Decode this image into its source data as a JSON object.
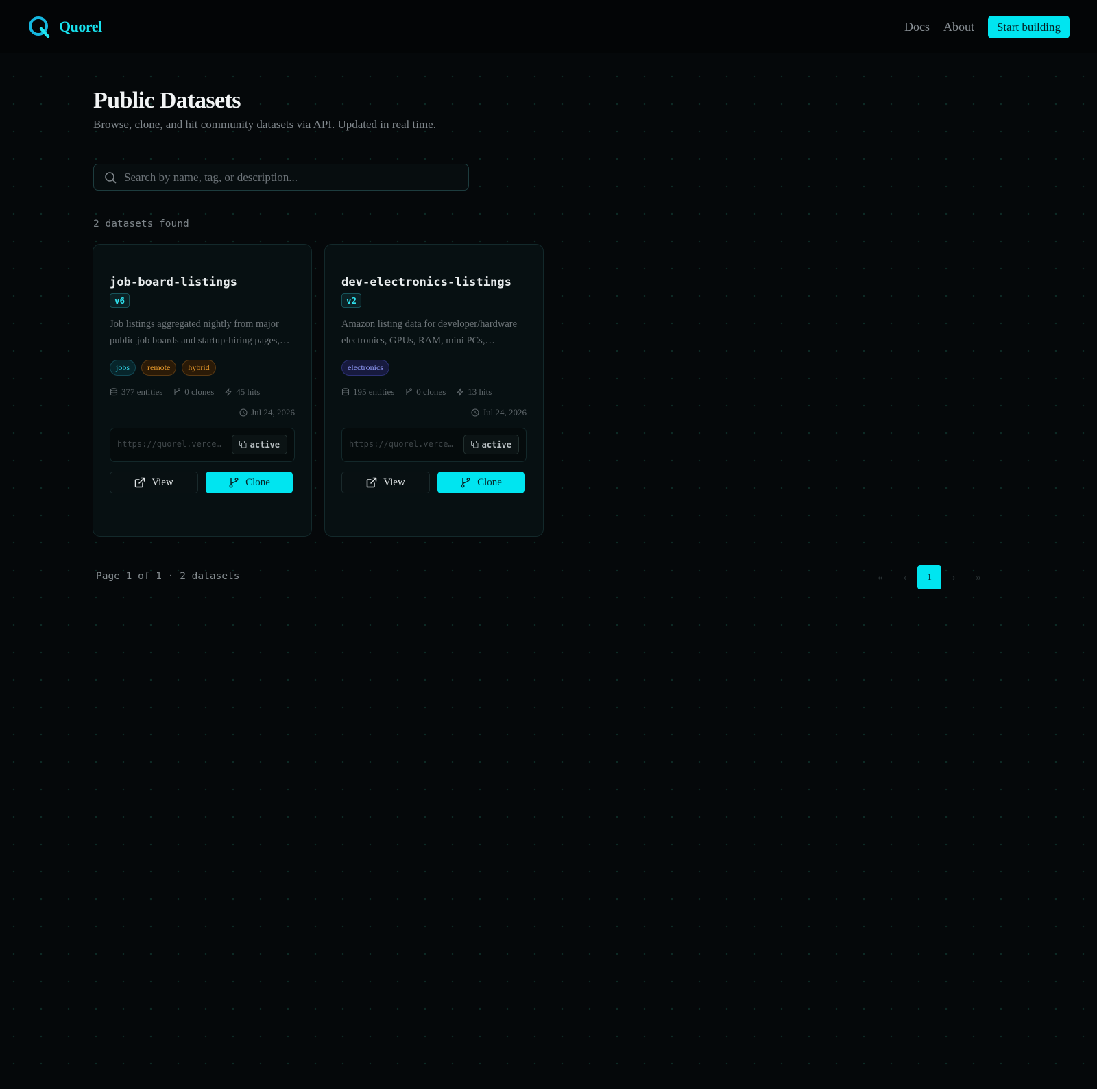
{
  "header": {
    "brand": "Quorel",
    "nav": {
      "docs": "Docs",
      "about": "About"
    },
    "cta": "Start building"
  },
  "page": {
    "title": "Public Datasets",
    "subtitle": "Browse, clone, and hit community datasets via API. Updated in real time."
  },
  "search": {
    "placeholder": "Search by name, tag, or description..."
  },
  "results": {
    "count_label": "2 datasets found"
  },
  "datasets": [
    {
      "name": "job-board-listings",
      "version": "v6",
      "description": "Job listings aggregated nightly from major public job boards and startup-hiring pages,…",
      "tags": [
        "jobs",
        "remote",
        "hybrid"
      ],
      "entities": "377 entities",
      "clones": "0 clones",
      "hits": "45 hits",
      "date": "Jul 24, 2026",
      "endpoint": "https://quorel.verce…",
      "status": "active",
      "view_label": "View",
      "clone_label": "Clone"
    },
    {
      "name": "dev-electronics-listings",
      "version": "v2",
      "description": "Amazon listing data for developer/hardware electronics, GPUs, RAM, mini PCs,…",
      "tags": [
        "electronics"
      ],
      "entities": "195 entities",
      "clones": "0 clones",
      "hits": "13 hits",
      "date": "Jul 24, 2026",
      "endpoint": "https://quorel.verce…",
      "status": "active",
      "view_label": "View",
      "clone_label": "Clone"
    }
  ],
  "pagination": {
    "info": "Page 1 of 1 · 2 datasets",
    "first": "«",
    "prev": "‹",
    "current": "1",
    "next": "›",
    "last": "»"
  },
  "colors": {
    "accent": "#00e5f0",
    "background": "#05080a",
    "tag_jobs": "#2fd6e8",
    "tag_remote": "#e79a2c",
    "tag_electronics": "#8e97f3"
  },
  "icons": {
    "logo": "q-logo-icon",
    "search": "search-icon",
    "entities": "database-icon",
    "clones": "git-branch-icon",
    "hits": "zap-icon",
    "date": "clock-icon",
    "copy": "copy-icon",
    "view": "external-link-icon",
    "clone": "git-branch-icon"
  }
}
